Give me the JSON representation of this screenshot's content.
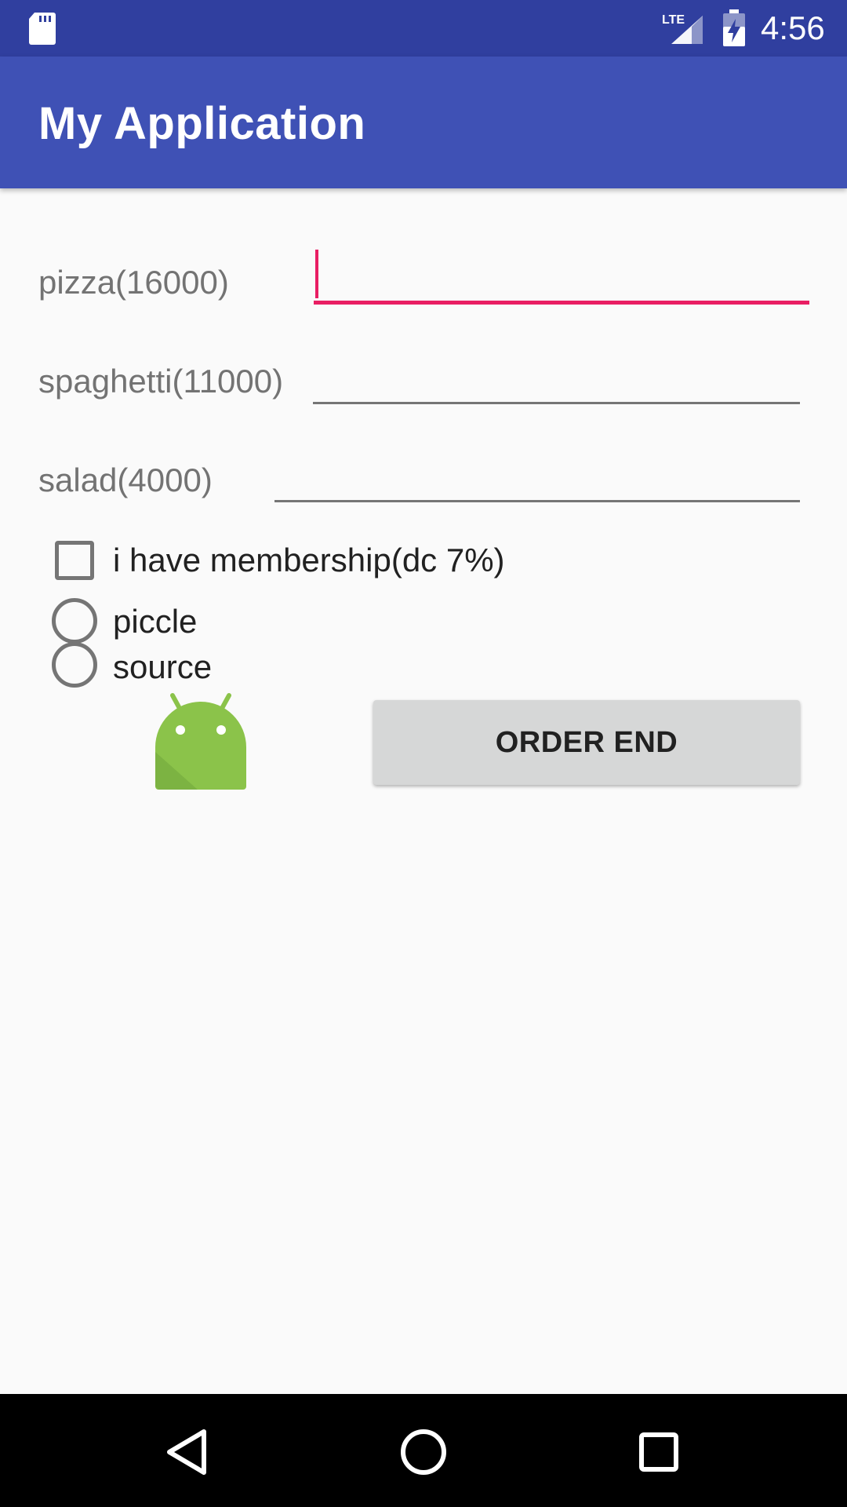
{
  "status_bar": {
    "time": "4:56",
    "network_label": "LTE",
    "icons": [
      "sd-card-icon",
      "lte-signal-icon",
      "battery-charging-icon"
    ]
  },
  "app_bar": {
    "title": "My Application"
  },
  "form": {
    "items": [
      {
        "label": "pizza(16000)",
        "value": ""
      },
      {
        "label": "spaghetti(11000)",
        "value": ""
      },
      {
        "label": "salad(4000)",
        "value": ""
      }
    ],
    "membership_checkbox": {
      "label": "i have membership(dc 7%)",
      "checked": false
    },
    "radio_options": [
      {
        "label": "piccle",
        "selected": false
      },
      {
        "label": "source",
        "selected": false
      }
    ],
    "order_button_label": "ORDER END"
  },
  "colors": {
    "status_bar": "#303f9f",
    "app_bar": "#3f51b5",
    "accent": "#e91e63",
    "android_green": "#8bc34a"
  },
  "nav_bar": {
    "icons": [
      "back-icon",
      "home-icon",
      "recent-apps-icon"
    ]
  }
}
